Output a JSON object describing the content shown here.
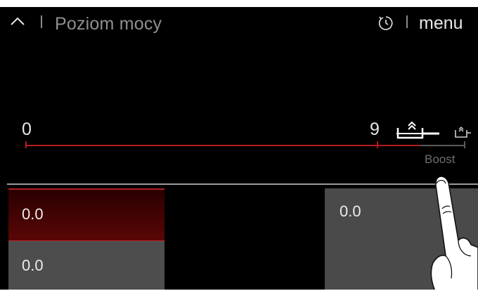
{
  "header": {
    "title": "Poziom mocy",
    "menu_label": "menu",
    "back_icon": "chevron-up-icon",
    "timer_icon": "timer-icon"
  },
  "power": {
    "min_label": "0",
    "max_label": "9",
    "boost_label": "Boost",
    "boost_icon": "boost-pot-icon",
    "colors": {
      "active": "#b51c1c",
      "inactive": "#5a5a5a"
    }
  },
  "zones": {
    "left_front": {
      "value": "0.0"
    },
    "left_rear": {
      "value": "0.0"
    },
    "right": {
      "value": "0.0"
    }
  }
}
